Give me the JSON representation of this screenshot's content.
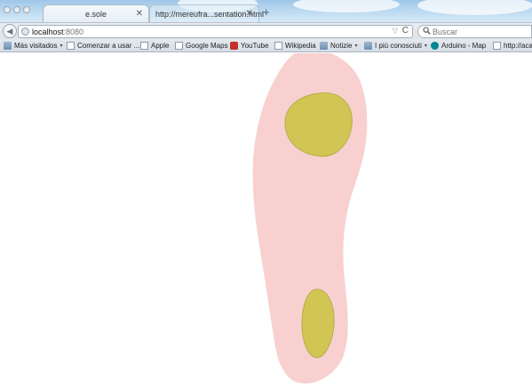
{
  "window": {
    "tabs": [
      {
        "label": "e.sole",
        "active": true
      },
      {
        "label": "http://mereufra...sentation.html",
        "active": false
      }
    ],
    "close_glyph": "✕",
    "new_tab_glyph": "+"
  },
  "navbar": {
    "back_glyph": "◀",
    "url_host": "localhost",
    "url_port": ":8080",
    "dropdown_glyph": "▽",
    "reload_glyph": "C",
    "search_placeholder": "Buscar",
    "search_icon": "search-icon"
  },
  "bookmarks": [
    {
      "label": "Más visitados",
      "icon": "folder-icon",
      "dropdown": true
    },
    {
      "label": "Comenzar a usar ...",
      "icon": "page-icon",
      "dropdown": false
    },
    {
      "label": "Apple",
      "icon": "page-icon",
      "dropdown": false
    },
    {
      "label": "Google Maps",
      "icon": "page-icon",
      "dropdown": false
    },
    {
      "label": "YouTube",
      "icon": "youtube-icon",
      "dropdown": false
    },
    {
      "label": "Wikipedia",
      "icon": "page-icon",
      "dropdown": false
    },
    {
      "label": "Notizie",
      "icon": "folder-icon",
      "dropdown": true
    },
    {
      "label": "I più conosciuti",
      "icon": "folder-icon",
      "dropdown": true
    },
    {
      "label": "Arduino - Map",
      "icon": "arduino-icon",
      "dropdown": false
    },
    {
      "label": "http://acad",
      "icon": "page-icon",
      "dropdown": false
    }
  ],
  "caret_glyph": "▾",
  "sole": {
    "fill": "#f8d0d0",
    "pressure_zone_fill": "#d1c653",
    "pressure_zone_stroke": "#b7ae4a",
    "zones": [
      "forefoot-pressure-zone",
      "heel-pressure-zone"
    ]
  }
}
